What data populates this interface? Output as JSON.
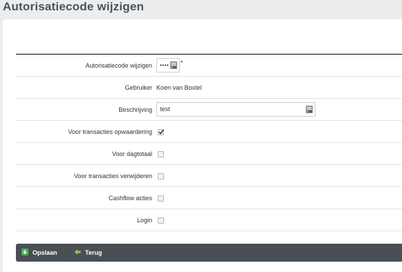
{
  "page": {
    "title": "Autorisatiecode wijzigen"
  },
  "form": {
    "rows": [
      {
        "label": "Autorisatiecode wijzigen",
        "type": "password",
        "value": "••••",
        "required_mark": "*"
      },
      {
        "label": "Gebruiker",
        "type": "text",
        "value": "Koen van Boxtel"
      },
      {
        "label": "Beschrijving",
        "type": "input",
        "value": "test"
      },
      {
        "label": "Voor transacties opwaardering",
        "type": "checkbox",
        "checked": true
      },
      {
        "label": "Voor dagtotaal",
        "type": "checkbox",
        "checked": false
      },
      {
        "label": "Voor transacties verwijderen",
        "type": "checkbox",
        "checked": false
      },
      {
        "label": "Cashflow acties",
        "type": "checkbox",
        "checked": false
      },
      {
        "label": "Login",
        "type": "checkbox",
        "checked": false
      }
    ]
  },
  "toolbar": {
    "save_label": "Opslaan",
    "save_icon": "save-icon",
    "back_label": "Terug",
    "back_icon": "arrow-left-icon"
  },
  "colors": {
    "toolbar_bg": "#494f55",
    "save_icon": "#4caf50",
    "back_icon": "#8bc34a"
  }
}
